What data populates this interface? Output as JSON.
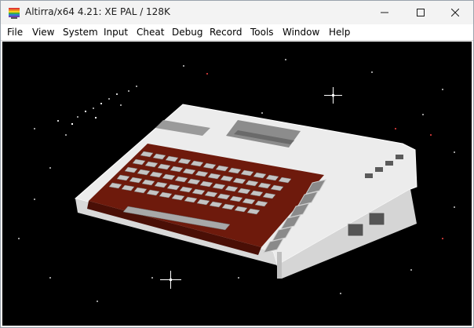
{
  "window": {
    "title": "Altirra/x64 4.21: XE PAL / 128K",
    "app_icon": "altirra-rainbow-logo-icon",
    "controls": {
      "minimize_icon": "minimize-icon",
      "maximize_icon": "maximize-icon",
      "close_icon": "close-icon"
    }
  },
  "menubar": {
    "items": [
      {
        "label": "File"
      },
      {
        "label": "View"
      },
      {
        "label": "System"
      },
      {
        "label": "Input"
      },
      {
        "label": "Cheat"
      },
      {
        "label": "Debug"
      },
      {
        "label": "Record"
      },
      {
        "label": "Tools"
      },
      {
        "label": "Window"
      },
      {
        "label": "Help"
      }
    ]
  },
  "emulator_display": {
    "content": "Atari XE computer pixel-art boot screen over starfield",
    "colors": {
      "background": "#000000",
      "case_white": "#e8e8e8",
      "case_brown": "#6e1a0c",
      "keys": "#bdbdbd",
      "function_keys": "#8a8a8a"
    }
  }
}
